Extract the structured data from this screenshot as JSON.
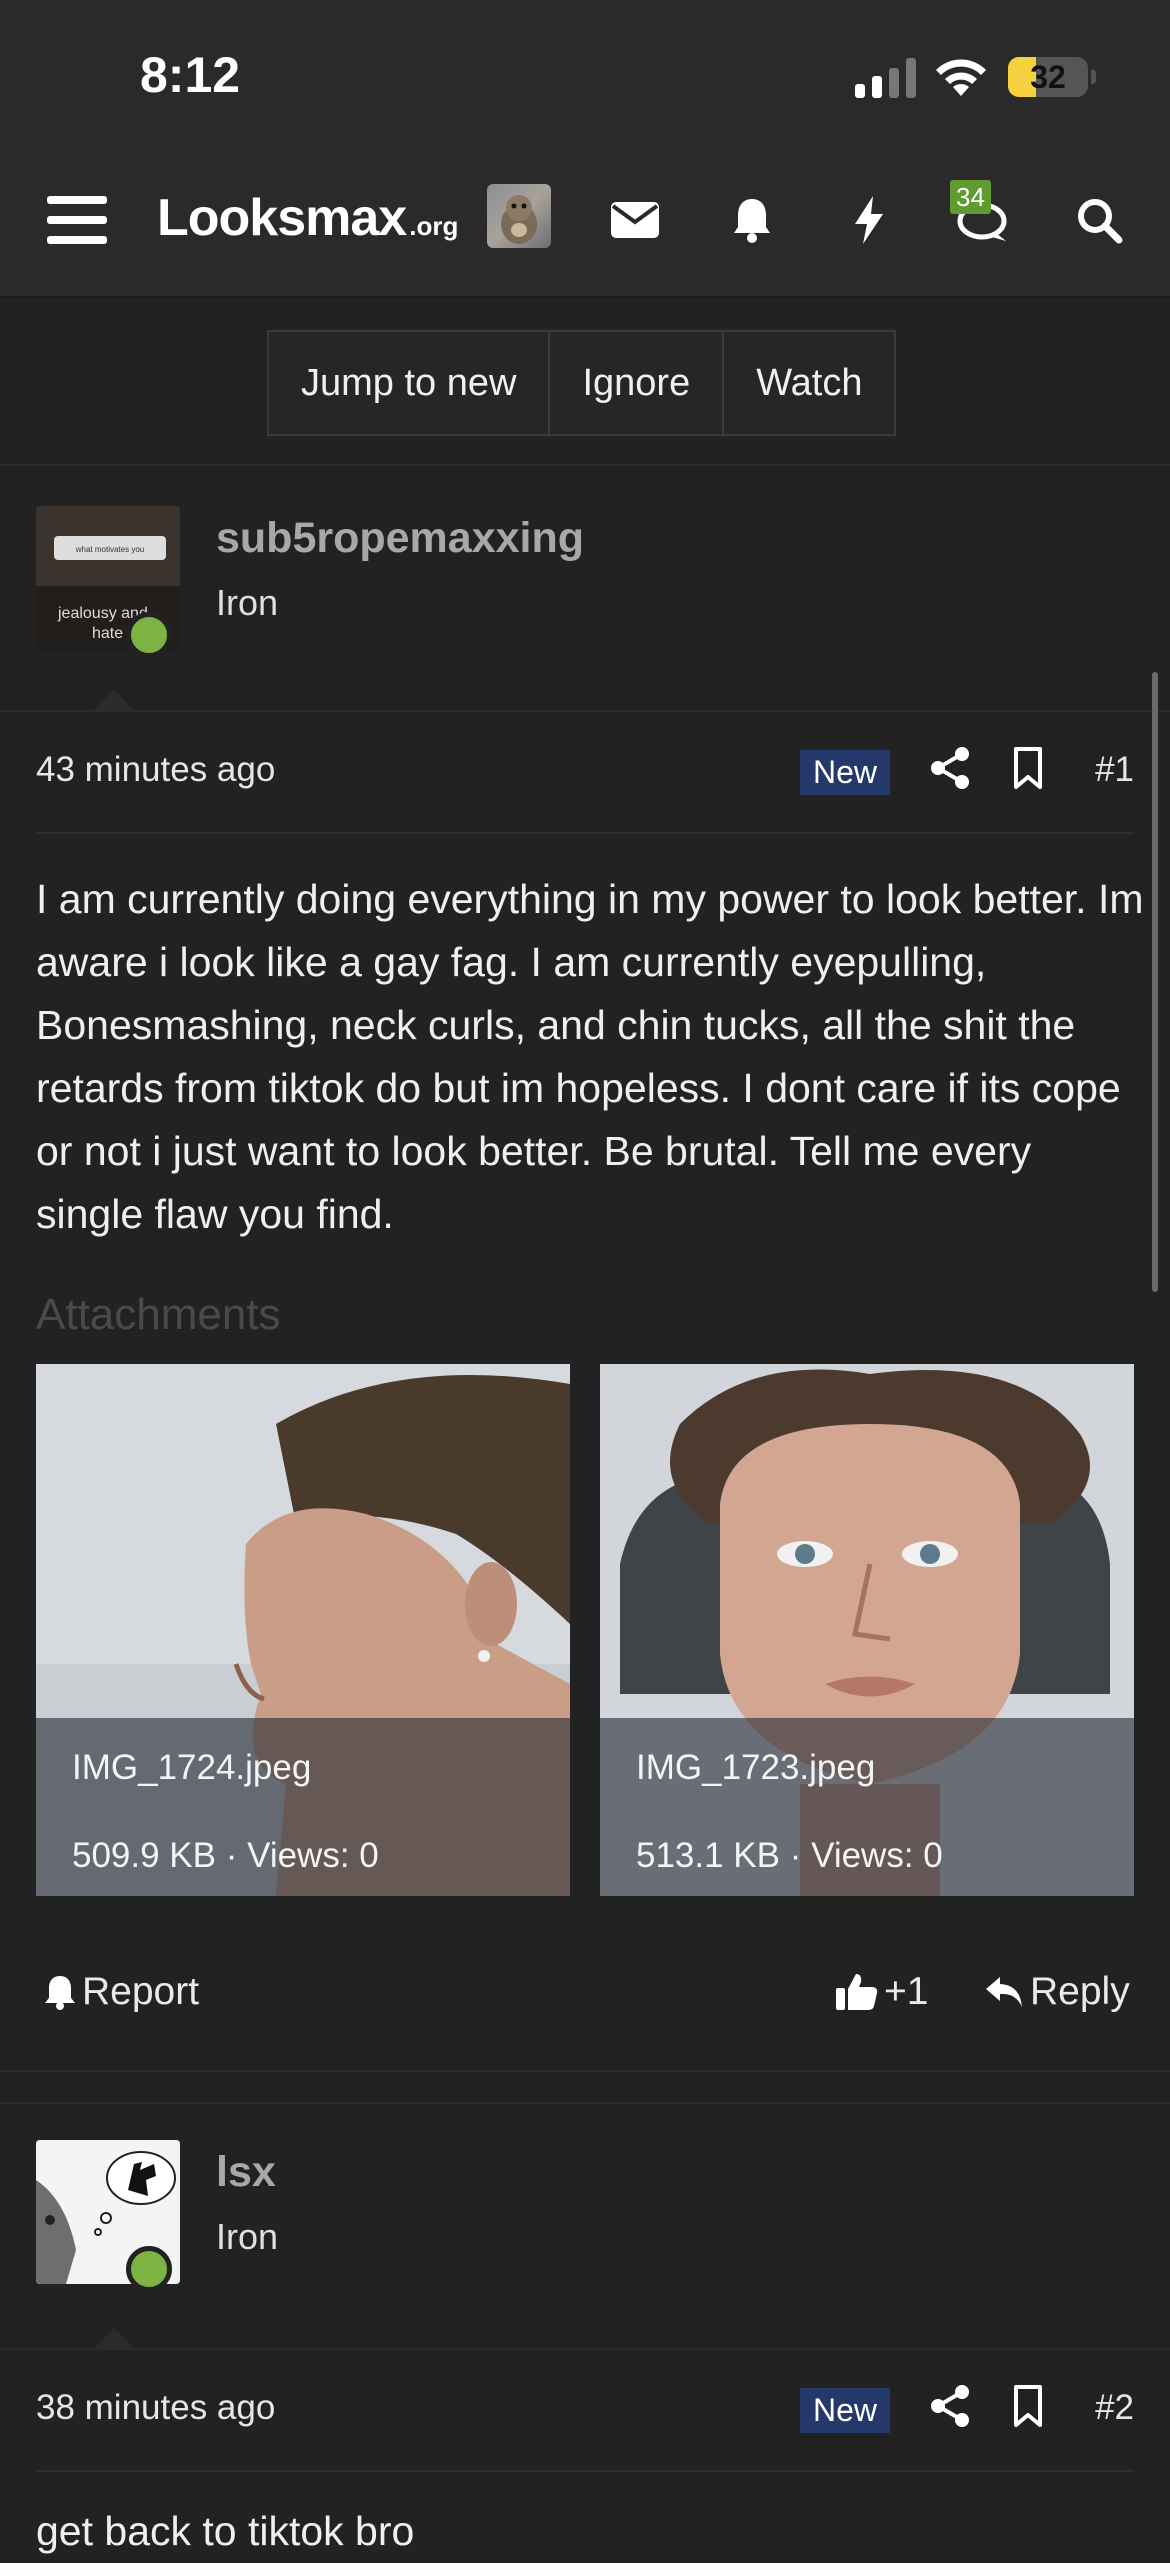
{
  "status": {
    "time": "8:12",
    "battery": "32"
  },
  "nav": {
    "logo_main": "Looksmax",
    "logo_org": ".org",
    "chat_badge": "34"
  },
  "thread_actions": [
    "Jump to new",
    "Ignore",
    "Watch"
  ],
  "posts": [
    {
      "username": "sub5ropemaxxing",
      "rank": "Iron",
      "ago": "43 minutes ago",
      "new_label": "New",
      "number": "#1",
      "body": "I am currently doing everything in my power to look better. Im aware i look like a gay fag. I am currently eyepulling, Bonesmashing, neck curls, and chin tucks, all the shit the retards from tiktok do but im hopeless. I dont care if its cope or not i just want to look better. Be brutal. Tell me every single flaw you find.",
      "attachments_label": "Attachments",
      "attachments": [
        {
          "filename": "IMG_1724.jpeg",
          "info": "509.9 KB · Views: 0"
        },
        {
          "filename": "IMG_1723.jpeg",
          "info": "513.1 KB · Views: 0"
        }
      ],
      "report_label": "Report",
      "like_label": "+1",
      "reply_label": "Reply",
      "avatar_text": [
        "what motivates you",
        "jealousy and",
        "hate"
      ]
    },
    {
      "username": "lsx",
      "rank": "Iron",
      "ago": "38 minutes ago",
      "new_label": "New",
      "number": "#2",
      "body": "get back to tiktok bro"
    }
  ]
}
